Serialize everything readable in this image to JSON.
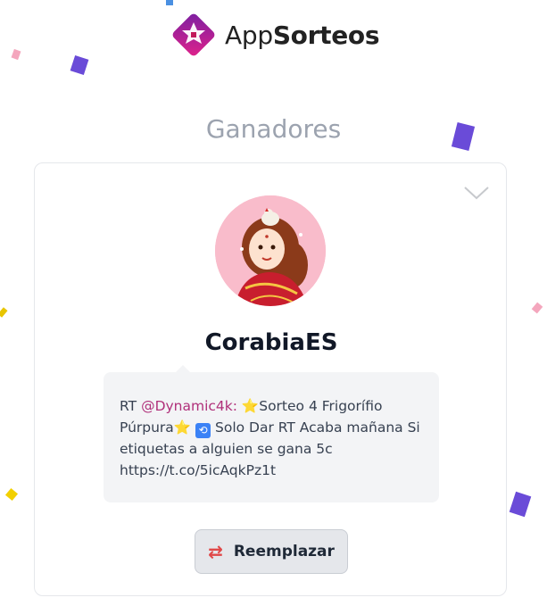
{
  "brand": {
    "name_regular": "App",
    "name_bold": "Sorteos",
    "colors": {
      "primary": "#8a1fb0",
      "accent": "#e0228a"
    }
  },
  "page": {
    "title": "Ganadores"
  },
  "winner": {
    "username": "CorabiaES",
    "avatar_icon": "profile-illustration",
    "tweet": {
      "prefix": "RT",
      "mention": "@Dynamic4k:",
      "part1": "Sorteo 4 Frigorífio Púrpura",
      "part2": "Solo Dar RT Acaba mañana Si etiquetas a alguien se gana 5c",
      "link": "https://t.co/5icAqkPz1t",
      "emoji_star": "⭐",
      "emoji_repeat": "🔁"
    }
  },
  "actions": {
    "replace_label": "Reemplazar",
    "replace_icon": "swap-arrows-icon"
  },
  "icons": {
    "collapse": "chevron-down-icon"
  }
}
